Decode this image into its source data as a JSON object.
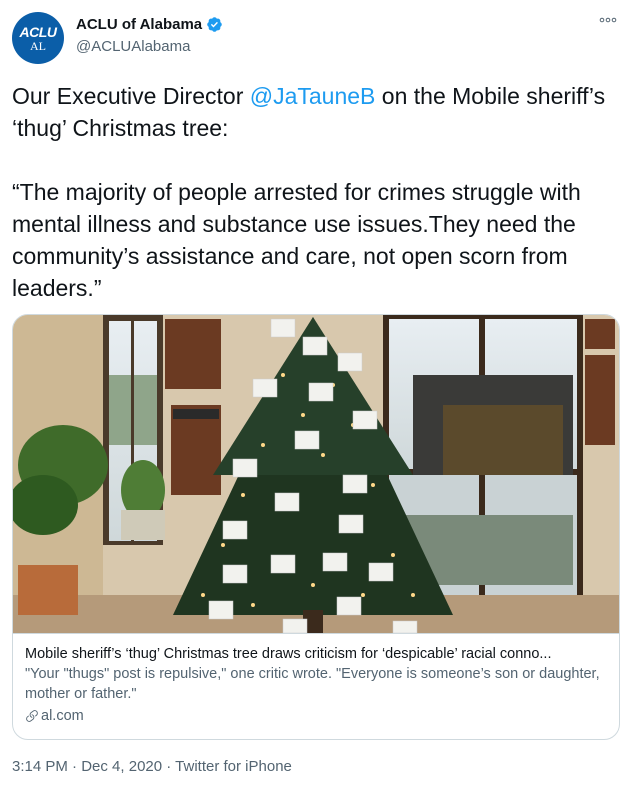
{
  "account": {
    "avatar_line1": "ACLU",
    "avatar_line2": "AL",
    "display_name": "ACLU of Alabama",
    "handle": "@ACLUAlabama"
  },
  "tweet": {
    "text_before_mention": "Our Executive Director ",
    "mention": "@JaTauneB",
    "text_after_mention": " on the Mobile sheriff’s ‘thug’ Christmas tree:\n\n“The majority of people arrested for crimes struggle with mental illness and substance use issues.They need the community’s assistance and care, not open scorn from leaders.”"
  },
  "card": {
    "title": "Mobile sheriff’s ‘thug’ Christmas tree draws criticism for ‘despicable’ racial conno...",
    "description": "\"Your \"thugs\" post is repulsive,\" one critic wrote. \"Everyone is someone’s son or daughter, mother or father.\"",
    "domain": "al.com"
  },
  "meta": {
    "time": "3:14 PM",
    "date": "Dec 4, 2020",
    "source": "Twitter for iPhone",
    "separator": " · "
  },
  "colors": {
    "link": "#1d9bf0",
    "secondary_text": "#536471",
    "avatar_bg": "#0b5ea8",
    "border": "#cfd9de"
  },
  "icons": [
    "verified-badge-icon",
    "more-options-icon",
    "link-icon"
  ]
}
